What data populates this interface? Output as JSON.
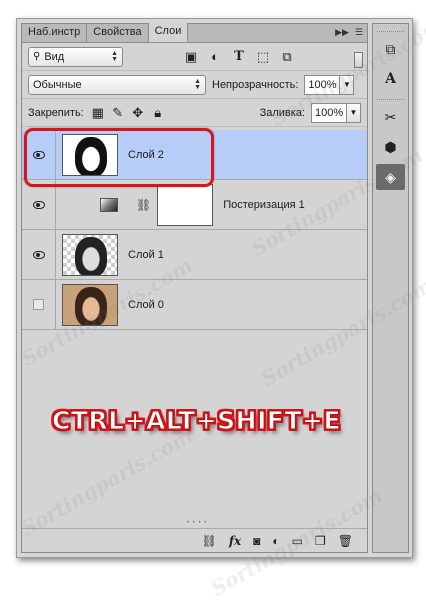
{
  "tabs": [
    {
      "label": "Наб.инстр",
      "active": false
    },
    {
      "label": "Свойства",
      "active": false
    },
    {
      "label": "Слои",
      "active": true
    }
  ],
  "filter": {
    "kind_label": "Вид"
  },
  "blend": {
    "mode": "Обычные",
    "opacity_label": "Непрозрачность:",
    "opacity_value": "100%"
  },
  "lock": {
    "label": "Закрепить:",
    "fill_label": "Заливка:",
    "fill_value": "100%"
  },
  "layers": [
    {
      "name": "Слой 2",
      "visible": true,
      "selected": true
    },
    {
      "name": "Постеризация 1",
      "visible": true,
      "selected": false
    },
    {
      "name": "Слой 1",
      "visible": true,
      "selected": false
    },
    {
      "name": "Слой 0",
      "visible": false,
      "selected": false
    }
  ],
  "overlay": {
    "shortcut": "CTRL+ALT+SHIFT+E",
    "highlight_color": "#d9141b"
  },
  "watermark": "Sortingparis.com",
  "colors": {
    "selection": "#b6cdf7",
    "panel": "#d4d4d4"
  }
}
